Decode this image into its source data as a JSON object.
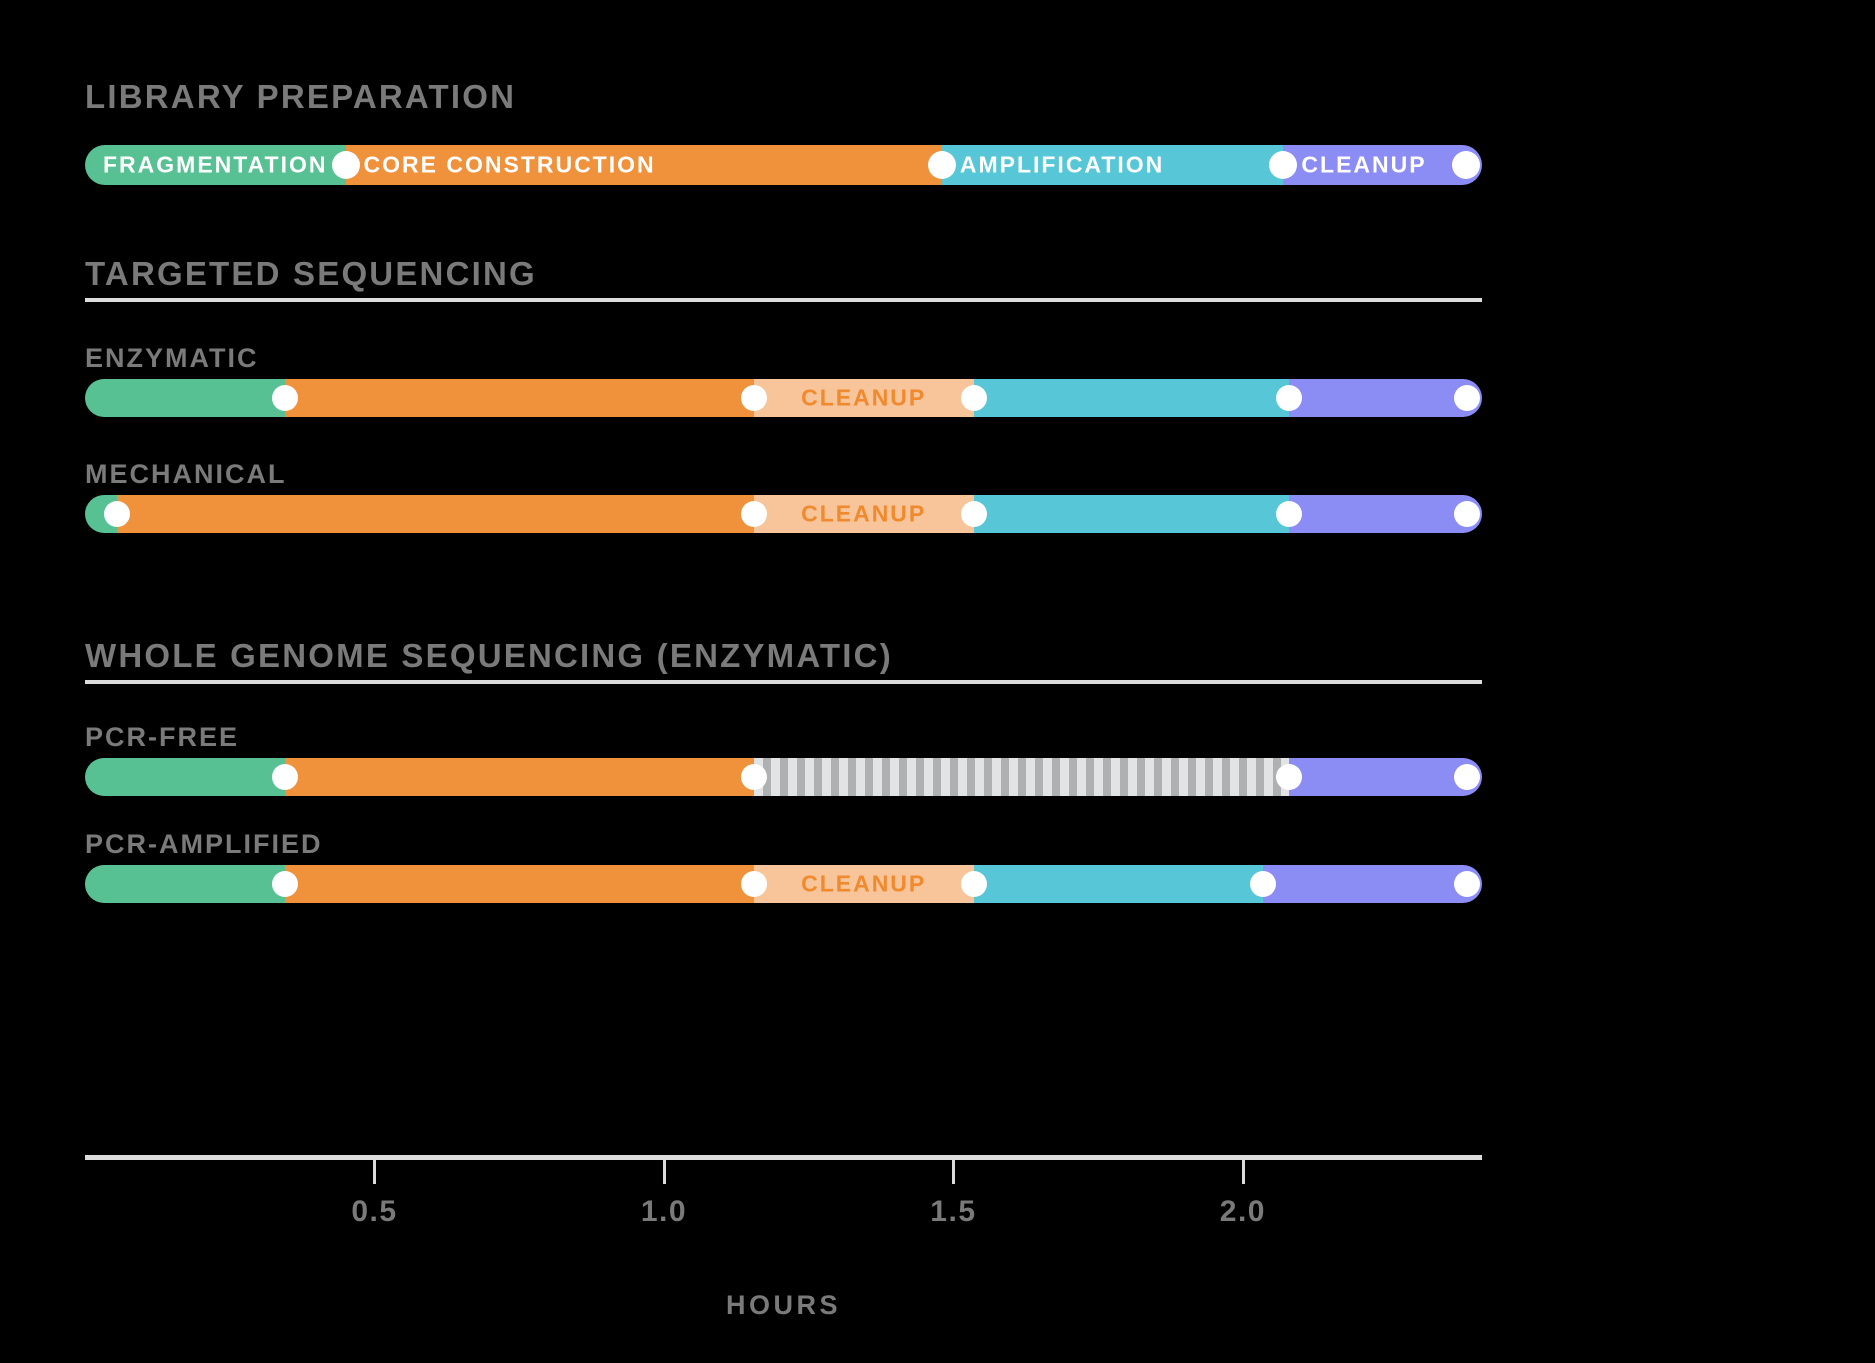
{
  "chart_data": {
    "type": "bar",
    "title": "",
    "xlabel": "HOURS",
    "ylabel": "",
    "xlim": [
      0.0,
      2.413
    ],
    "grid": false,
    "legend_position": "top",
    "axis": {
      "label": "HOURS",
      "ticks": [
        {
          "value": 0.5,
          "label": "0.5"
        },
        {
          "value": 1.0,
          "label": "1.0"
        },
        {
          "value": 1.5,
          "label": "1.5"
        },
        {
          "value": 2.0,
          "label": "2.0"
        }
      ]
    },
    "stage_colors": {
      "fragmentation": "#57c193",
      "core_construction": "#f0923c",
      "cleanup": "#f8c49a",
      "amplification": "#57c6d6",
      "final_cleanup": "#8b8cf4",
      "hatched_incubation": "#cfd1d3",
      "marker": "#ffffff"
    },
    "legend": {
      "entries": [
        {
          "label": "FRAGMENTATION",
          "color": "#57c193",
          "start": 0.0,
          "end": 0.45
        },
        {
          "label": "CORE CONSTRUCTION",
          "color": "#f0923c",
          "start": 0.45,
          "end": 1.48
        },
        {
          "label": "AMPLIFICATION",
          "color": "#57c6d6",
          "start": 1.48,
          "end": 2.07
        },
        {
          "label": "CLEANUP",
          "color": "#8b8cf4",
          "start": 2.07,
          "end": 2.413
        }
      ]
    },
    "sections": [
      {
        "title": "LIBRARY PREPARATION",
        "has_rule": false,
        "rows": [
          {
            "label": "",
            "is_legend": true,
            "segments": [
              {
                "stage": "FRAGMENTATION",
                "color": "#57c193",
                "start": 0.0,
                "end": 0.45,
                "label": "FRAGMENTATION",
                "label_style": "onbar"
              },
              {
                "stage": "CORE CONSTRUCTION",
                "color": "#f0923c",
                "start": 0.45,
                "end": 1.48,
                "label": "CORE CONSTRUCTION",
                "label_style": "onbar"
              },
              {
                "stage": "AMPLIFICATION",
                "color": "#57c6d6",
                "start": 1.48,
                "end": 2.07,
                "label": "AMPLIFICATION",
                "label_style": "onbar"
              },
              {
                "stage": "CLEANUP",
                "color": "#8b8cf4",
                "start": 2.07,
                "end": 2.413,
                "label": "CLEANUP",
                "label_style": "onbar"
              }
            ],
            "markers": [
              0.45,
              1.48,
              2.07,
              2.413
            ]
          }
        ]
      },
      {
        "title": "TARGETED SEQUENCING",
        "has_rule": true,
        "rows": [
          {
            "label": "ENZYMATIC",
            "is_legend": false,
            "segments": [
              {
                "stage": "FRAGMENTATION",
                "color": "#57c193",
                "start": 0.0,
                "end": 0.345,
                "label": "",
                "label_style": "none"
              },
              {
                "stage": "CORE CONSTRUCTION",
                "color": "#f0923c",
                "start": 0.345,
                "end": 1.155,
                "label": "",
                "label_style": "none"
              },
              {
                "stage": "CLEANUP",
                "color": "#f8c49a",
                "start": 1.155,
                "end": 1.535,
                "label": "CLEANUP",
                "label_style": "cleanup"
              },
              {
                "stage": "AMPLIFICATION",
                "color": "#57c6d6",
                "start": 1.535,
                "end": 2.08,
                "label": "",
                "label_style": "none"
              },
              {
                "stage": "CLEANUP",
                "color": "#8b8cf4",
                "start": 2.08,
                "end": 2.413,
                "label": "",
                "label_style": "none"
              }
            ],
            "markers": [
              0.345,
              1.155,
              1.535,
              2.08,
              2.413
            ]
          },
          {
            "label": "MECHANICAL",
            "is_legend": false,
            "segments": [
              {
                "stage": "FRAGMENTATION",
                "color": "#57c193",
                "start": 0.0,
                "end": 0.055,
                "label": "",
                "label_style": "none"
              },
              {
                "stage": "CORE CONSTRUCTION",
                "color": "#f0923c",
                "start": 0.055,
                "end": 1.155,
                "label": "",
                "label_style": "none"
              },
              {
                "stage": "CLEANUP",
                "color": "#f8c49a",
                "start": 1.155,
                "end": 1.535,
                "label": "CLEANUP",
                "label_style": "cleanup"
              },
              {
                "stage": "AMPLIFICATION",
                "color": "#57c6d6",
                "start": 1.535,
                "end": 2.08,
                "label": "",
                "label_style": "none"
              },
              {
                "stage": "CLEANUP",
                "color": "#8b8cf4",
                "start": 2.08,
                "end": 2.413,
                "label": "",
                "label_style": "none"
              }
            ],
            "markers": [
              0.055,
              1.155,
              1.535,
              2.08,
              2.413
            ]
          }
        ]
      },
      {
        "title": "WHOLE GENOME SEQUENCING (ENZYMATIC)",
        "has_rule": true,
        "rows": [
          {
            "label": "PCR-FREE",
            "is_legend": false,
            "segments": [
              {
                "stage": "FRAGMENTATION",
                "color": "#57c193",
                "start": 0.0,
                "end": 0.345,
                "label": "",
                "label_style": "none"
              },
              {
                "stage": "CORE CONSTRUCTION",
                "color": "#f0923c",
                "start": 0.345,
                "end": 1.155,
                "label": "",
                "label_style": "none"
              },
              {
                "stage": "HATCHED",
                "color": "striped",
                "start": 1.155,
                "end": 2.08,
                "label": "",
                "label_style": "none"
              },
              {
                "stage": "CLEANUP",
                "color": "#8b8cf4",
                "start": 2.08,
                "end": 2.413,
                "label": "",
                "label_style": "none"
              }
            ],
            "markers": [
              0.345,
              1.155,
              2.08,
              2.413
            ]
          },
          {
            "label": "PCR-AMPLIFIED",
            "is_legend": false,
            "segments": [
              {
                "stage": "FRAGMENTATION",
                "color": "#57c193",
                "start": 0.0,
                "end": 0.345,
                "label": "",
                "label_style": "none"
              },
              {
                "stage": "CORE CONSTRUCTION",
                "color": "#f0923c",
                "start": 0.345,
                "end": 1.155,
                "label": "",
                "label_style": "none"
              },
              {
                "stage": "CLEANUP",
                "color": "#f8c49a",
                "start": 1.155,
                "end": 1.535,
                "label": "CLEANUP",
                "label_style": "cleanup"
              },
              {
                "stage": "AMPLIFICATION",
                "color": "#57c6d6",
                "start": 1.535,
                "end": 2.035,
                "label": "",
                "label_style": "none"
              },
              {
                "stage": "CLEANUP",
                "color": "#8b8cf4",
                "start": 2.035,
                "end": 2.413,
                "label": "",
                "label_style": "none"
              }
            ],
            "markers": [
              0.345,
              1.155,
              1.535,
              2.035,
              2.413
            ]
          }
        ]
      }
    ]
  }
}
